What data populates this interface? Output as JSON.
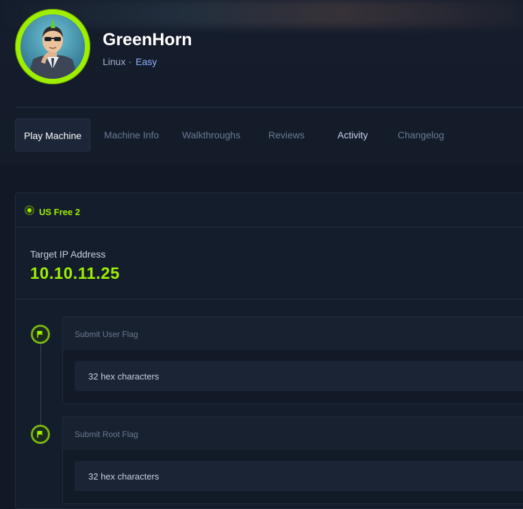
{
  "machine": {
    "name": "GreenHorn",
    "os": "Linux",
    "separator": "·",
    "difficulty": "Easy"
  },
  "avatar": {
    "icon": "hacker-character-avatar",
    "ring_color": "#9fef00"
  },
  "tabs": [
    {
      "label": "Play Machine",
      "active": true
    },
    {
      "label": "Machine Info",
      "active": false
    },
    {
      "label": "Walkthroughs",
      "active": false
    },
    {
      "label": "Reviews",
      "active": false
    },
    {
      "label": "Activity",
      "active": false
    },
    {
      "label": "Changelog",
      "active": false
    }
  ],
  "server": {
    "name": "US Free 2",
    "status_color": "#9fef00"
  },
  "target": {
    "label": "Target IP Address",
    "ip": "10.10.11.25"
  },
  "flags": [
    {
      "title": "Submit User Flag",
      "placeholder": "32 hex characters",
      "icon": "flag-icon"
    },
    {
      "title": "Submit Root Flag",
      "placeholder": "32 hex characters",
      "icon": "flag-icon"
    }
  ],
  "colors": {
    "accent": "#9fef00",
    "background": "#111927",
    "link": "#8fb3ff"
  }
}
